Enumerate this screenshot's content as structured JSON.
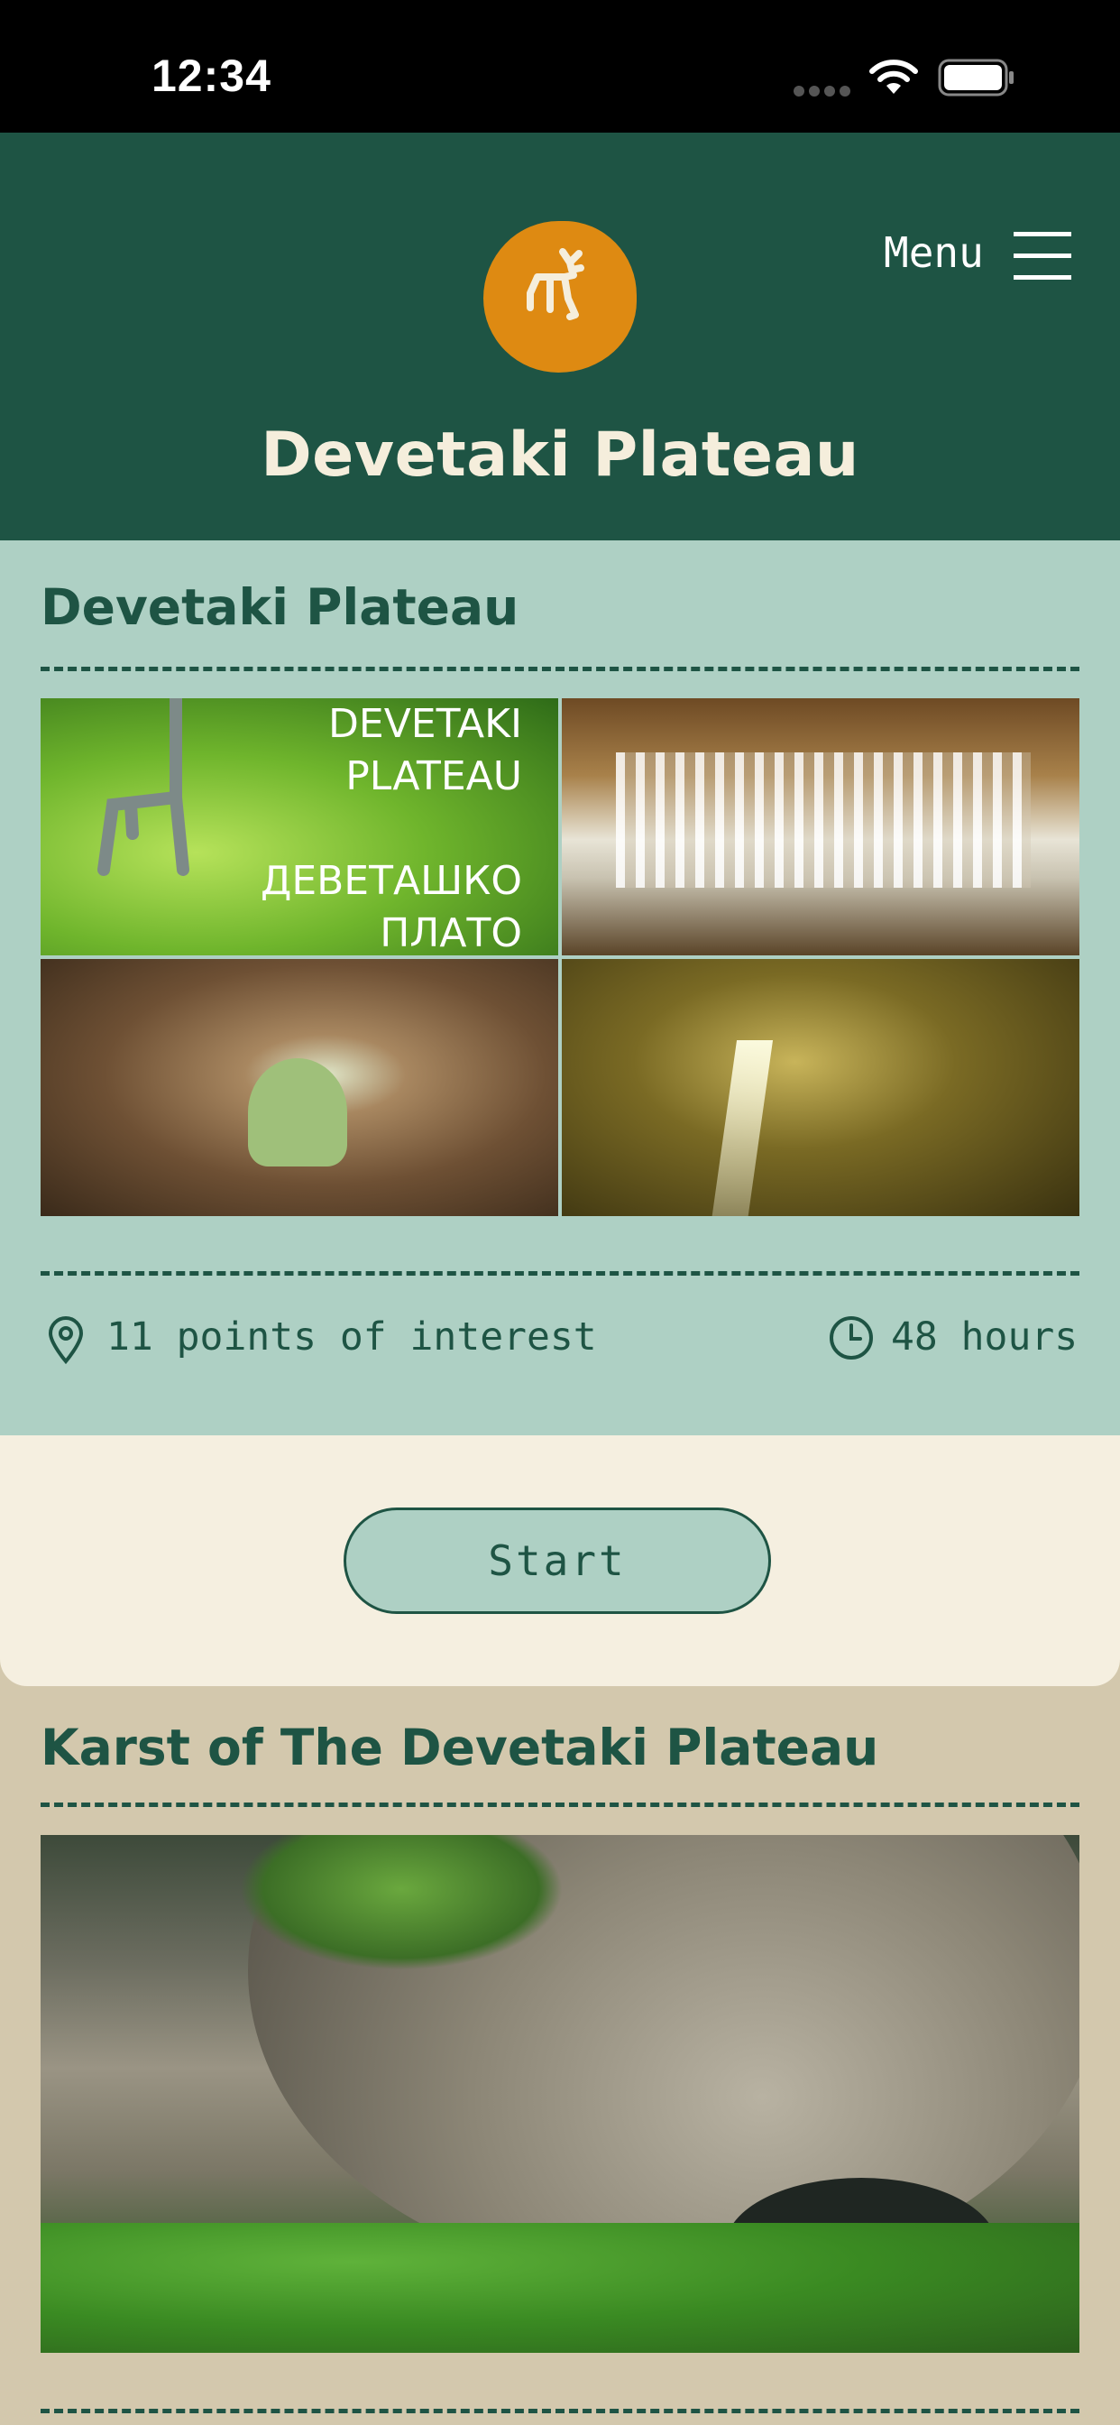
{
  "status_bar": {
    "time": "12:34"
  },
  "header": {
    "menu_label": "Menu",
    "title": "Devetaki Plateau"
  },
  "route_card": {
    "title": "Devetaki Plateau",
    "poster_text": "DEVETAKI\nPLATEAU\n\nДЕВЕТАШКО\nПЛАТО",
    "points_of_interest": "11 points of interest",
    "duration": "48 hours",
    "start_label": "Start"
  },
  "second_card": {
    "title": "Karst of The Devetaki Plateau"
  },
  "colors": {
    "brand_green": "#1e5444",
    "mint": "#aed0c4",
    "cream": "#f5efe0",
    "sand": "#d3c8ad",
    "logo_orange": "#de8a12"
  }
}
